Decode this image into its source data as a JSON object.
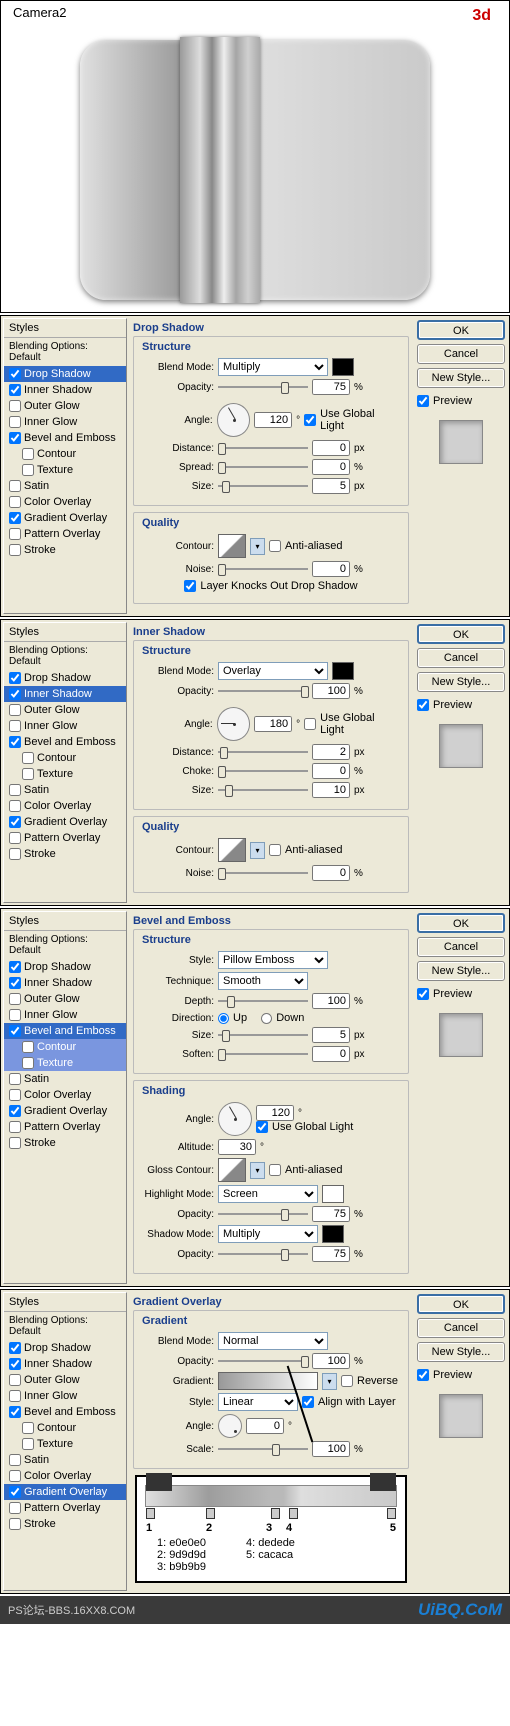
{
  "top": {
    "title": "Camera2",
    "badge": "3d"
  },
  "styles_header": "Styles",
  "blending_default": "Blending Options: Default",
  "style_options": {
    "drop_shadow": "Drop Shadow",
    "inner_shadow": "Inner Shadow",
    "outer_glow": "Outer Glow",
    "inner_glow": "Inner Glow",
    "bevel_emboss": "Bevel and Emboss",
    "contour": "Contour",
    "texture": "Texture",
    "satin": "Satin",
    "color_overlay": "Color Overlay",
    "gradient_overlay": "Gradient Overlay",
    "pattern_overlay": "Pattern Overlay",
    "stroke": "Stroke"
  },
  "labels": {
    "blend_mode": "Blend Mode:",
    "opacity": "Opacity:",
    "angle": "Angle:",
    "distance": "Distance:",
    "spread": "Spread:",
    "choke": "Choke:",
    "size": "Size:",
    "contour": "Contour:",
    "noise": "Noise:",
    "use_global": "Use Global Light",
    "anti": "Anti-aliased",
    "knockout": "Layer Knocks Out Drop Shadow",
    "style": "Style:",
    "technique": "Technique:",
    "depth": "Depth:",
    "direction": "Direction:",
    "up": "Up",
    "down": "Down",
    "soften": "Soften:",
    "altitude": "Altitude:",
    "gloss": "Gloss Contour:",
    "highlight": "Highlight Mode:",
    "shadowm": "Shadow Mode:",
    "gradient": "Gradient:",
    "reverse": "Reverse",
    "align": "Align with Layer",
    "scale": "Scale:",
    "pct": "%",
    "px": "px",
    "deg": "°"
  },
  "groups": {
    "structure": "Structure",
    "quality": "Quality",
    "shading": "Shading",
    "gradient": "Gradient"
  },
  "buttons": {
    "ok": "OK",
    "cancel": "Cancel",
    "new_style": "New Style...",
    "preview": "Preview"
  },
  "panel1": {
    "title": "Drop Shadow",
    "blend": "Multiply",
    "opacity": "75",
    "angle": "120",
    "global": true,
    "distance": "0",
    "spread": "0",
    "size": "5",
    "noise": "0",
    "knockout": true
  },
  "panel2": {
    "title": "Inner Shadow",
    "blend": "Overlay",
    "opacity": "100",
    "angle": "180",
    "global": false,
    "distance": "2",
    "choke": "0",
    "size": "10",
    "noise": "0"
  },
  "panel3": {
    "title": "Bevel and Emboss",
    "style": "Pillow Emboss",
    "technique": "Smooth",
    "depth": "100",
    "direction": "up",
    "size": "5",
    "soften": "0",
    "angle": "120",
    "global": true,
    "altitude": "30",
    "highlight": "Screen",
    "h_opacity": "75",
    "shadow": "Multiply",
    "s_opacity": "75"
  },
  "panel4": {
    "title": "Gradient Overlay",
    "blend": "Normal",
    "opacity": "100",
    "reverse": false,
    "style": "Linear",
    "align": true,
    "angle": "0",
    "scale": "100"
  },
  "gradient_stops": {
    "nums": [
      "1",
      "2",
      "3",
      "4",
      "5"
    ],
    "legend": [
      {
        "k": "1:",
        "v": "e0e0e0"
      },
      {
        "k": "2:",
        "v": "9d9d9d"
      },
      {
        "k": "3:",
        "v": "b9b9b9"
      },
      {
        "k": "4:",
        "v": "dedede"
      },
      {
        "k": "5:",
        "v": "cacaca"
      }
    ]
  },
  "footer": {
    "left": "PS论坛-BBS.16XX8.COM",
    "right": "UiBQ.CoM"
  }
}
